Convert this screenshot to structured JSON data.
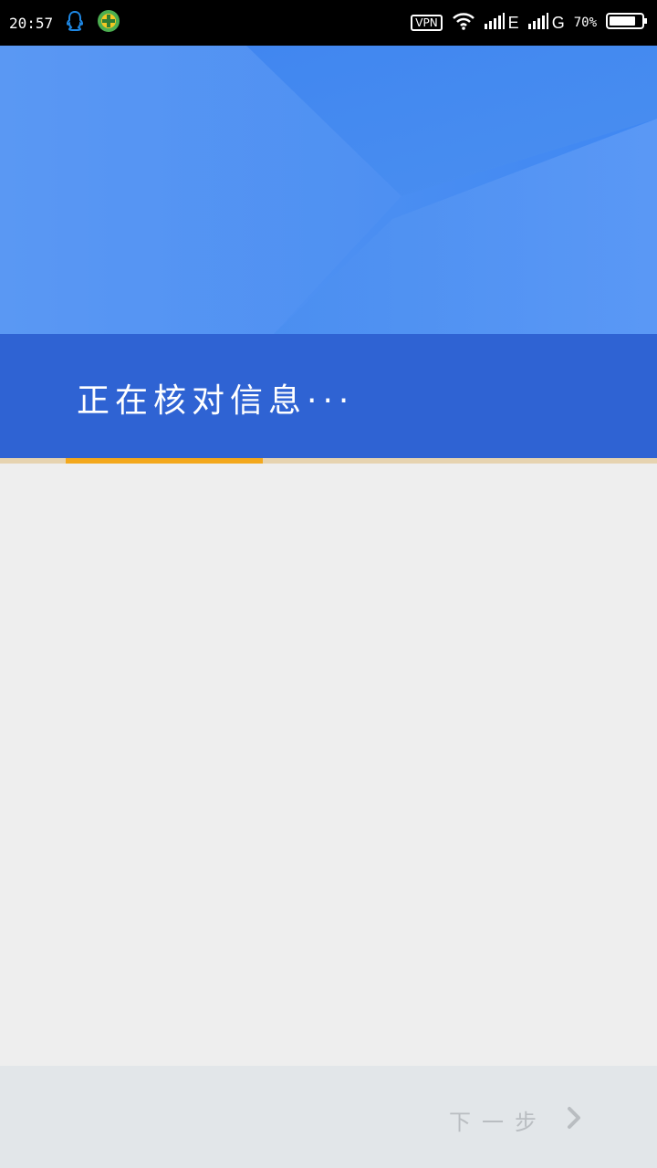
{
  "statusbar": {
    "time": "20:57",
    "vpn": "VPN",
    "net1": "E",
    "net2": "G",
    "battery_percent": "70",
    "icons": [
      "qq-icon",
      "green-plus-app-icon",
      "wifi-icon",
      "signal-icon",
      "signal-icon",
      "battery-icon"
    ]
  },
  "header": {
    "title": "正在核对信息···"
  },
  "progress": {
    "value": 0.3,
    "colors": {
      "fill": "#f3a81c",
      "track": "#e6d3b0"
    }
  },
  "bottom": {
    "next_label": "下一步",
    "next_icon": "chevron-right-icon"
  },
  "colors": {
    "header_top": "#4d8ff0",
    "header_band": "#2f63d3",
    "page_bg": "#eeeeee",
    "bottom_bg": "#e2e6e9",
    "next_text": "#b9bdc1"
  }
}
